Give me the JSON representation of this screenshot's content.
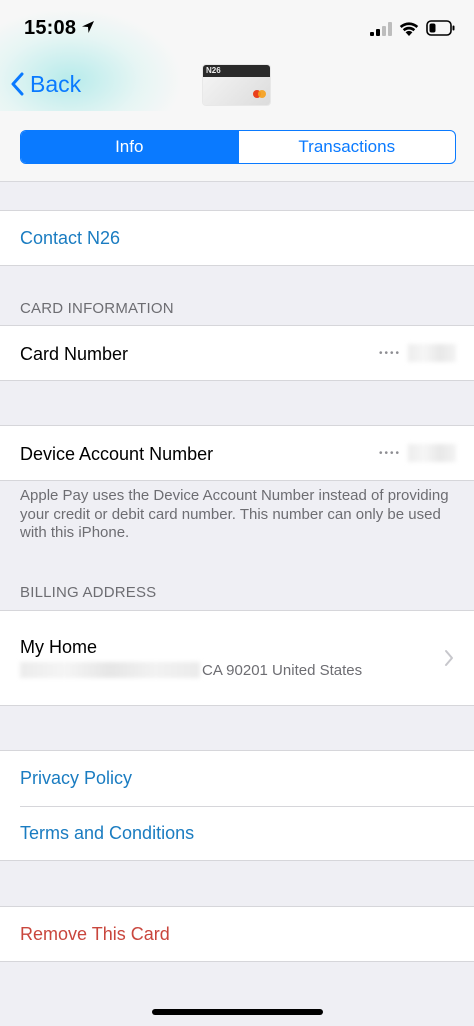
{
  "status_bar": {
    "time": "15:08"
  },
  "nav": {
    "back_label": "Back",
    "card_logo_text": "N26"
  },
  "segments": {
    "info": "Info",
    "transactions": "Transactions",
    "selected": "Info"
  },
  "contact": {
    "label": "Contact N26"
  },
  "card_information": {
    "header": "CARD INFORMATION",
    "card_number_label": "Card Number",
    "card_number_masked": "••••",
    "device_account_label": "Device Account Number",
    "device_account_masked": "••••",
    "note": "Apple Pay uses the Device Account Number instead of providing your credit or debit card number. This number can only be used with this iPhone."
  },
  "billing": {
    "header": "BILLING ADDRESS",
    "name": "My Home",
    "address_visible": "CA 90201 United States"
  },
  "links": {
    "privacy": "Privacy Policy",
    "terms": "Terms and Conditions"
  },
  "remove": {
    "label": "Remove This Card"
  },
  "colors": {
    "accent": "#0a7aff",
    "link": "#1a7cc1",
    "danger": "#c9463d",
    "background": "#efeff4"
  }
}
